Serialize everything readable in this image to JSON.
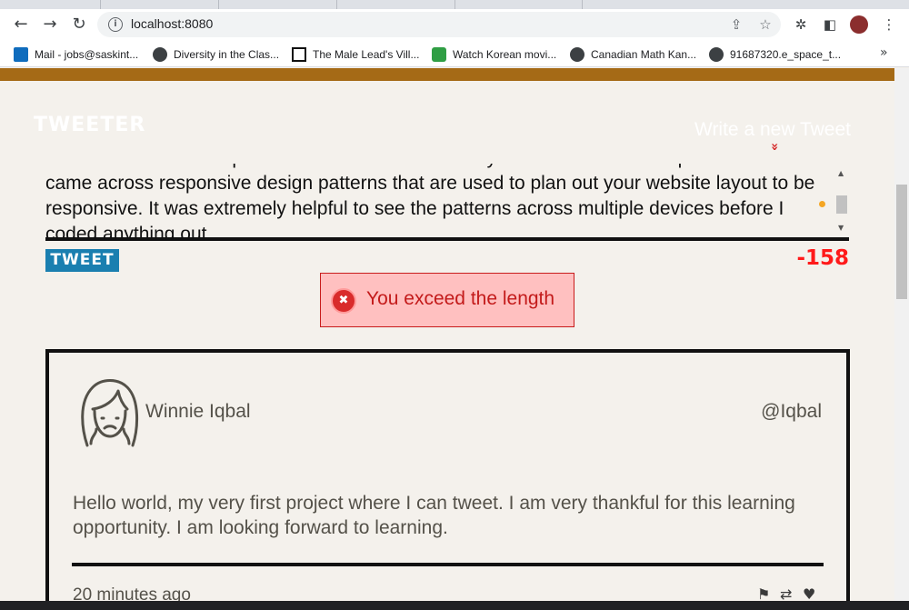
{
  "browser": {
    "url": "localhost:8080",
    "nav": {
      "back_icon": "arrow-left-icon",
      "forward_icon": "arrow-right-icon",
      "reload_icon": "reload-icon"
    },
    "glyphs": {
      "back": "←",
      "forward": "→",
      "reload": "↻",
      "info": "i",
      "share": "⇪",
      "star": "☆",
      "extensions": "✲",
      "sidepanel": "◧",
      "menu": "⋮",
      "more": "»"
    },
    "bookmarks": [
      {
        "label": "Mail - jobs@saskint...",
        "icon": "outlook-icon"
      },
      {
        "label": "Diversity in the Clas...",
        "icon": "globe-icon"
      },
      {
        "label": "The Male Lead's Vill...",
        "icon": "notion-icon"
      },
      {
        "label": "Watch Korean movi...",
        "icon": "check-icon"
      },
      {
        "label": "Canadian Math Kan...",
        "icon": "globe-icon"
      },
      {
        "label": "91687320.e_space_t...",
        "icon": "globe-icon"
      }
    ]
  },
  "header": {
    "logo": "TWEETER",
    "compose_link": "Write a new Tweet",
    "compose_chevron": "»"
  },
  "composer": {
    "text": "about what is more important which is the website layout and its overall responsiveness. I came across responsive design patterns that are used to plan out your website layout to be responsive. It was extremely helpful to see the patterns across multiple devices before I coded anything out.",
    "tweet_button": "TWEET",
    "counter": "-158"
  },
  "error": {
    "icon_glyph": "✖",
    "message": "You exceed the length"
  },
  "tweets": [
    {
      "name": "Winnie Iqbal",
      "handle": "@Iqbal",
      "content": "Hello world, my very first project where I can tweet. I am very thankful for this learning opportunity. I am looking forward to learning.",
      "time": "20 minutes ago",
      "actions": {
        "flag": "⚑",
        "retweet": "⇄",
        "like": "♥"
      }
    }
  ],
  "colors": {
    "accent_bar": "#a56a16",
    "tweet_button": "#1a7fb0",
    "counter": "#ff1a1a",
    "error_bg": "#ffc0c0",
    "error_text": "#c31a1a",
    "page_bg": "#f4f1ec"
  }
}
